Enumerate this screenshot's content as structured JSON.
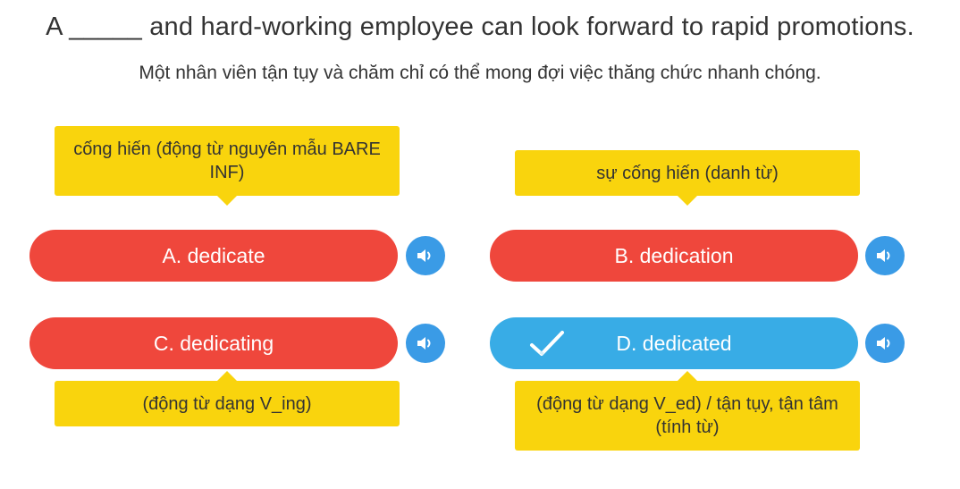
{
  "question": {
    "text": "A _____ and hard-working employee can look forward to rapid promotions.",
    "translation": "Một nhân viên tận tụy và chăm chỉ có thể mong đợi việc thăng chức nhanh chóng."
  },
  "options": [
    {
      "label": "A. dedicate",
      "hint": "cống hiến (động từ nguyên mẫu BARE INF)",
      "selected": false
    },
    {
      "label": "B. dedication",
      "hint": "sự cống hiến (danh từ)",
      "selected": false
    },
    {
      "label": "C. dedicating",
      "hint": "(động từ dạng V_ing)",
      "selected": false
    },
    {
      "label": "D. dedicated",
      "hint": "(động từ dạng V_ed) / tận tụy, tận tâm (tính từ)",
      "selected": true
    }
  ],
  "icons": {
    "speaker": "speaker-icon",
    "check": "checkmark-icon"
  },
  "colors": {
    "option_default": "#ef473c",
    "option_correct": "#38ace6",
    "speaker": "#3a9be6",
    "hint": "#f9d40d"
  }
}
